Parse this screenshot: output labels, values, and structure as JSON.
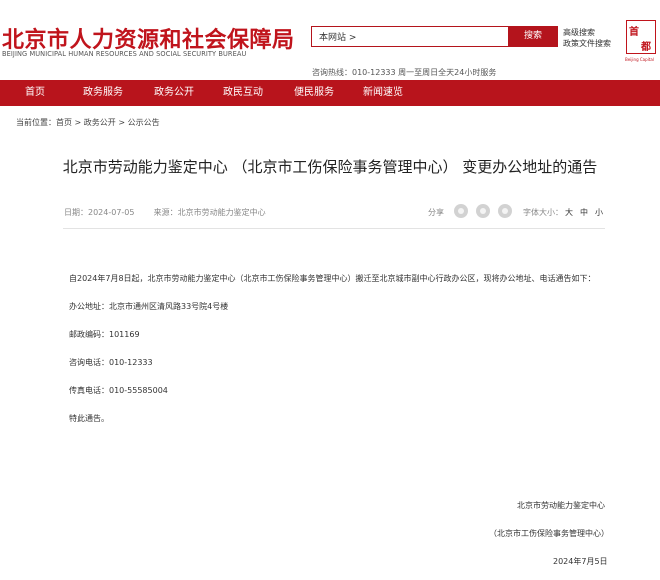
{
  "header": {
    "logo_cn": "北京市人力资源和社会保障局",
    "logo_en": "BEIJING MUNICIPAL HUMAN RESOURCES AND SOCIAL SECURITY BUREAU",
    "search_scope": "本网站 >",
    "search_button": "搜索",
    "advanced_search": "高级搜索",
    "policy_search": "政策文件搜索",
    "hotline": "咨询热线：010-12333 周一至周日全天24小时服务",
    "seal": {
      "line1": "首",
      "line2": "都",
      "sub": "Beijing Capital"
    }
  },
  "nav": {
    "items": [
      "首页",
      "政务服务",
      "政务公开",
      "政民互动",
      "便民服务",
      "新闻速览"
    ]
  },
  "breadcrumb": {
    "text": "当前位置：首页 > 政务公开 > 公示公告"
  },
  "article": {
    "title": "北京市劳动能力鉴定中心 （北京市工伤保险事务管理中心） 变更办公地址的通告",
    "date": "日期：2024-07-05",
    "source": "来源：北京市劳动能力鉴定中心",
    "share_label": "分享",
    "font_size_label": "字体大小：",
    "font_sizes": [
      "大",
      "中",
      "小"
    ],
    "paragraphs": [
      "自2024年7月8日起，北京市劳动能力鉴定中心（北京市工伤保险事务管理中心）搬迁至北京城市副中心行政办公区，现将办公地址、电话通告如下：",
      "办公地址：北京市通州区清风路33号院4号楼",
      "邮政编码：101169",
      "咨询电话：010-12333",
      "传真电话：010-55585004",
      "特此通告。"
    ],
    "signature": {
      "org": "北京市劳动能力鉴定中心",
      "org2": "（北京市工伤保险事务管理中心）",
      "date": "2024年7月5日"
    }
  },
  "colors": {
    "brand_red": "#b8141c",
    "text": "#333333",
    "muted": "#888888"
  }
}
